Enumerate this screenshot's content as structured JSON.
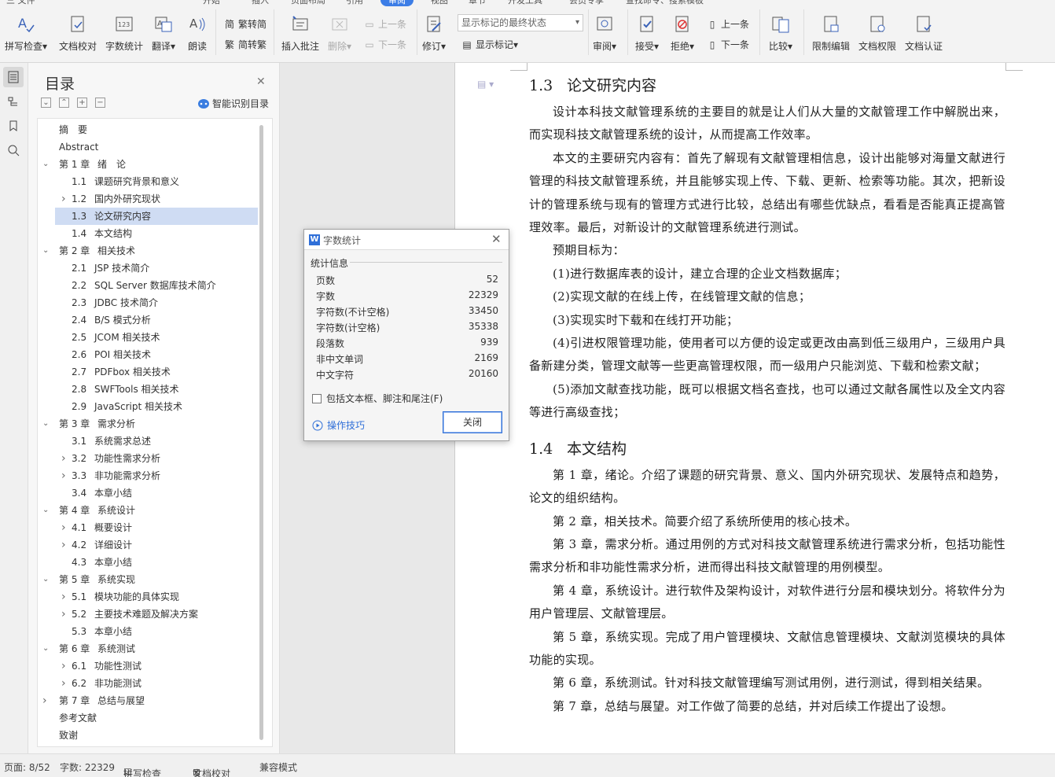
{
  "ribbon": {
    "buttons": [
      {
        "label": "拼写检查",
        "icon": "spell-check-icon"
      },
      {
        "label": "文档校对",
        "icon": "doc-proof-icon"
      },
      {
        "label": "字数统计",
        "icon": "word-count-icon"
      },
      {
        "label": "翻译",
        "icon": "translate-icon"
      },
      {
        "label": "朗读",
        "icon": "read-aloud-icon"
      },
      {
        "label": "插入批注",
        "icon": "insert-comment-icon"
      },
      {
        "label": "删除",
        "icon": "delete-comment-icon"
      },
      {
        "label": "修订",
        "icon": "track-changes-icon"
      },
      {
        "label": "审阅",
        "icon": "review-icon"
      },
      {
        "label": "接受",
        "icon": "accept-icon"
      },
      {
        "label": "拒绝",
        "icon": "reject-icon"
      },
      {
        "label": "比较",
        "icon": "compare-icon"
      },
      {
        "label": "限制编辑",
        "icon": "restrict-edit-icon"
      },
      {
        "label": "文档权限",
        "icon": "doc-permission-icon"
      },
      {
        "label": "文档认证",
        "icon": "doc-auth-icon"
      }
    ],
    "trad_to_simp": "繁转简",
    "simp_to_trad": "简转繁",
    "prev_comment": "上一条",
    "next_comment": "下一条",
    "markup_mode": "显示标记的最终状态",
    "show_markup": "显示标记",
    "prev_change": "上一条",
    "next_change": "下一条"
  },
  "toc": {
    "title": "目录",
    "smart_label": "智能识别目录",
    "items": [
      {
        "num": "摘　要",
        "text": "",
        "level": 0,
        "arrow": ""
      },
      {
        "num": "Abstract",
        "text": "",
        "level": 0,
        "arrow": ""
      },
      {
        "num": "第 1 章",
        "text": "绪　论",
        "level": 0,
        "arrow": "down"
      },
      {
        "num": "1.1",
        "text": "课题研究背景和意义",
        "level": 1,
        "arrow": ""
      },
      {
        "num": "1.2",
        "text": "国内外研究现状",
        "level": 1,
        "arrow": "right"
      },
      {
        "num": "1.3",
        "text": "论文研究内容",
        "level": 1,
        "arrow": "",
        "selected": true
      },
      {
        "num": "1.4",
        "text": "本文结构",
        "level": 1,
        "arrow": ""
      },
      {
        "num": "第 2 章",
        "text": "相关技术",
        "level": 0,
        "arrow": "down"
      },
      {
        "num": "2.1",
        "text": "JSP 技术简介",
        "level": 1,
        "arrow": ""
      },
      {
        "num": "2.2",
        "text": "SQL Server 数据库技术简介",
        "level": 1,
        "arrow": ""
      },
      {
        "num": "2.3",
        "text": "JDBC  技术简介",
        "level": 1,
        "arrow": ""
      },
      {
        "num": "2.4",
        "text": "B/S 模式分析",
        "level": 1,
        "arrow": ""
      },
      {
        "num": "2.5",
        "text": "JCOM  相关技术",
        "level": 1,
        "arrow": ""
      },
      {
        "num": "2.6",
        "text": "POI  相关技术",
        "level": 1,
        "arrow": ""
      },
      {
        "num": "2.7",
        "text": "PDFbox  相关技术",
        "level": 1,
        "arrow": ""
      },
      {
        "num": "2.8",
        "text": "SWFTools  相关技术",
        "level": 1,
        "arrow": ""
      },
      {
        "num": "2.9",
        "text": "JavaScript 相关技术",
        "level": 1,
        "arrow": ""
      },
      {
        "num": "第 3 章",
        "text": "需求分析",
        "level": 0,
        "arrow": "down"
      },
      {
        "num": "3.1",
        "text": "系统需求总述",
        "level": 1,
        "arrow": ""
      },
      {
        "num": "3.2",
        "text": "功能性需求分析",
        "level": 1,
        "arrow": "right"
      },
      {
        "num": "3.3",
        "text": "非功能需求分析",
        "level": 1,
        "arrow": "right"
      },
      {
        "num": "3.4",
        "text": "本章小结",
        "level": 1,
        "arrow": ""
      },
      {
        "num": "第 4 章",
        "text": "系统设计",
        "level": 0,
        "arrow": "down"
      },
      {
        "num": "4.1",
        "text": "概要设计",
        "level": 1,
        "arrow": "right"
      },
      {
        "num": "4.2",
        "text": "详细设计",
        "level": 1,
        "arrow": "right"
      },
      {
        "num": "4.3",
        "text": "本章小结",
        "level": 1,
        "arrow": ""
      },
      {
        "num": "第 5 章",
        "text": "系统实现",
        "level": 0,
        "arrow": "down"
      },
      {
        "num": "5.1",
        "text": "模块功能的具体实现",
        "level": 1,
        "arrow": "right"
      },
      {
        "num": "5.2",
        "text": "主要技术难题及解决方案",
        "level": 1,
        "arrow": "right"
      },
      {
        "num": "5.3",
        "text": "本章小结",
        "level": 1,
        "arrow": ""
      },
      {
        "num": "第 6 章",
        "text": "系统测试",
        "level": 0,
        "arrow": "down"
      },
      {
        "num": "6.1",
        "text": "功能性测试",
        "level": 1,
        "arrow": "right"
      },
      {
        "num": "6.2",
        "text": "非功能测试",
        "level": 1,
        "arrow": "right"
      },
      {
        "num": "第 7 章",
        "text": "总结与展望",
        "level": 0,
        "arrow": "right"
      },
      {
        "num": "参考文献",
        "text": "",
        "level": 0,
        "arrow": ""
      },
      {
        "num": "致谢",
        "text": "",
        "level": 0,
        "arrow": ""
      }
    ]
  },
  "doc": {
    "sec13_num": "1.3",
    "sec13_title": "论文研究内容",
    "sec13_paras": [
      "设计本科技文献管理系统的主要目的就是让人们从大量的文献管理工作中解脱出来，而实现科技文献管理系统的设计，从而提高工作效率。",
      "本文的主要研究内容有：首先了解现有文献管理相信息，设计出能够对海量文献进行管理的科技文献管理系统，并且能够实现上传、下载、更新、检索等功能。其次，把新设计的管理系统与现有的管理方式进行比较，总结出有哪些优缺点，看看是否能真正提高管理效率。最后，对新设计的文献管理系统进行测试。",
      "预期目标为：",
      "(1)进行数据库表的设计，建立合理的企业文档数据库；",
      "(2)实现文献的在线上传，在线管理文献的信息；",
      "(3)实现实时下载和在线打开功能；",
      "(4)引进权限管理功能，使用者可以方便的设定或更改由高到低三级用户，三级用户具备新建分类，管理文献等一些更高管理权限，而一级用户只能浏览、下载和检索文献；",
      "(5)添加文献查找功能，既可以根据文档名查找，也可以通过文献各属性以及全文内容等进行高级查找；"
    ],
    "sec14_num": "1.4",
    "sec14_title": "本文结构",
    "sec14_paras": [
      "第 1 章，绪论。介绍了课题的研究背景、意义、国内外研究现状、发展特点和趋势，论文的组织结构。",
      "第 2 章，相关技术。简要介绍了系统所使用的核心技术。",
      "第 3 章，需求分析。通过用例的方式对科技文献管理系统进行需求分析，包括功能性需求分析和非功能性需求分析，进而得出科技文献管理的用例模型。",
      "第 4 章，系统设计。进行软件及架构设计，对软件进行分层和模块划分。将软件分为用户管理层、文献管理层。",
      "第 5 章，系统实现。完成了用户管理模块、文献信息管理模块、文献浏览模块的具体功能的实现。",
      "第 6 章，系统测试。针对科技文献管理编写测试用例，进行测试，得到相关结果。",
      "第 7 章，总结与展望。对工作做了简要的总结，并对后续工作提出了设想。"
    ]
  },
  "dialog": {
    "title": "字数统计",
    "group": "统计信息",
    "rows": [
      {
        "k": "页数",
        "v": "52"
      },
      {
        "k": "字数",
        "v": "22329"
      },
      {
        "k": "字符数(不计空格)",
        "v": "33450"
      },
      {
        "k": "字符数(计空格)",
        "v": "35338"
      },
      {
        "k": "段落数",
        "v": "939"
      },
      {
        "k": "非中文单词",
        "v": "2169"
      },
      {
        "k": "中文字符",
        "v": "20160"
      }
    ],
    "checkbox_label": "包括文本框、脚注和尾注(F)",
    "tips_label": "操作技巧",
    "close_label": "关闭"
  },
  "status": {
    "page": "页面: 8/52",
    "words": "字数: 22329",
    "spell": "拼写检查",
    "proof": "文档校对",
    "compat": "兼容模式"
  },
  "colors": {
    "accent": "#2f6fd8",
    "selected_row": "#cfdcf3"
  }
}
